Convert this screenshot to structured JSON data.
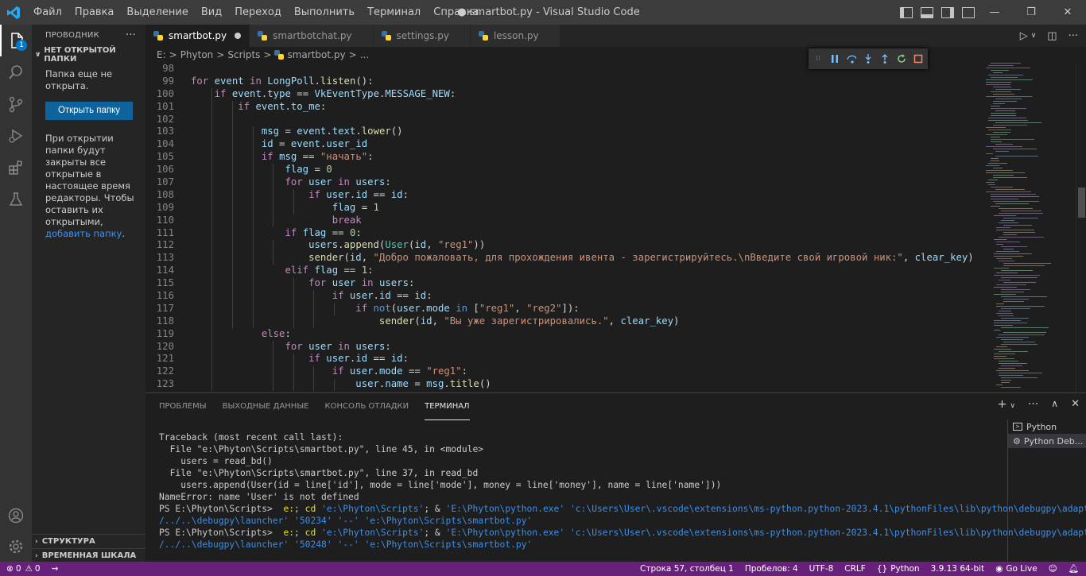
{
  "window": {
    "title": "● smartbot.py - Visual Studio Code"
  },
  "menu": [
    "Файл",
    "Правка",
    "Выделение",
    "Вид",
    "Переход",
    "Выполнить",
    "Терминал",
    "Справка"
  ],
  "sidebar": {
    "title": "ПРОВОДНИК",
    "section": "НЕТ ОТКРЫТОЙ ПАПКИ",
    "no_folder_text": "Папка еще не открыта.",
    "open_folder_label": "Открыть папку",
    "info_text": "При открытии папки будут закрыты все открытые в настоящее время редакторы. Чтобы оставить их открытыми, ",
    "info_link": "добавить папку",
    "info_end": ".",
    "outline": "СТРУКТУРА",
    "timeline": "ВРЕМЕННАЯ ШКАЛА",
    "badge": "1"
  },
  "tabs": [
    {
      "label": "smartbot.py",
      "active": true,
      "modified": true
    },
    {
      "label": "smartbotchat.py",
      "active": false
    },
    {
      "label": "settings.py",
      "active": false
    },
    {
      "label": "lesson.py",
      "active": false
    }
  ],
  "breadcrumb": [
    "E:",
    ">",
    "Phyton",
    ">",
    "Scripts",
    ">",
    "smartbot.py",
    ">",
    "..."
  ],
  "code_lines": [
    {
      "n": "98",
      "html": ""
    },
    {
      "n": "99",
      "html": "<span class=\"k\">for</span> <span class=\"v\">event</span> <span class=\"k\">in</span> <span class=\"v\">LongPoll</span>.<span class=\"f\">listen</span>():"
    },
    {
      "n": "100",
      "html": "    <span class=\"k\">if</span> <span class=\"v\">event</span>.<span class=\"v\">type</span> == <span class=\"v\">VkEventType</span>.<span class=\"v\">MESSAGE_NEW</span>:"
    },
    {
      "n": "101",
      "html": "        <span class=\"k\">if</span> <span class=\"v\">event</span>.<span class=\"v\">to_me</span>:"
    },
    {
      "n": "102",
      "html": ""
    },
    {
      "n": "103",
      "html": "            <span class=\"v\">msg</span> = <span class=\"v\">event</span>.<span class=\"v\">text</span>.<span class=\"f\">lower</span>()"
    },
    {
      "n": "104",
      "html": "            <span class=\"v\">id</span> = <span class=\"v\">event</span>.<span class=\"v\">user_id</span>"
    },
    {
      "n": "105",
      "html": "            <span class=\"k\">if</span> <span class=\"v\">msg</span> == <span class=\"s\">\"начать\"</span>:"
    },
    {
      "n": "106",
      "html": "                <span class=\"v\">flag</span> = <span class=\"n\">0</span>"
    },
    {
      "n": "107",
      "html": "                <span class=\"k\">for</span> <span class=\"v\">user</span> <span class=\"k\">in</span> <span class=\"v\">users</span>:"
    },
    {
      "n": "108",
      "html": "                    <span class=\"k\">if</span> <span class=\"v\">user</span>.<span class=\"v\">id</span> == <span class=\"v\">id</span>:"
    },
    {
      "n": "109",
      "html": "                        <span class=\"v\">flag</span> = <span class=\"n\">1</span>"
    },
    {
      "n": "110",
      "html": "                        <span class=\"k\">break</span>"
    },
    {
      "n": "111",
      "html": "                <span class=\"k\">if</span> <span class=\"v\">flag</span> == <span class=\"n\">0</span>:"
    },
    {
      "n": "112",
      "html": "                    <span class=\"v\">users</span>.<span class=\"f\">append</span>(<span class=\"c\">User</span>(<span class=\"v\">id</span>, <span class=\"s\">\"reg1\"</span>))"
    },
    {
      "n": "113",
      "html": "                    <span class=\"f\">sender</span>(<span class=\"v\">id</span>, <span class=\"s\">\"Добро пожаловать, для прохождения ивента - зарегистрируйтесь.\\nВведите свой игровой ник:\"</span>, <span class=\"v\">clear_key</span>)"
    },
    {
      "n": "114",
      "html": "                <span class=\"k\">elif</span> <span class=\"v\">flag</span> == <span class=\"n\">1</span>:"
    },
    {
      "n": "115",
      "html": "                    <span class=\"k\">for</span> <span class=\"v\">user</span> <span class=\"k\">in</span> <span class=\"v\">users</span>:"
    },
    {
      "n": "116",
      "html": "                        <span class=\"k\">if</span> <span class=\"v\">user</span>.<span class=\"v\">id</span> == <span class=\"v\">id</span>:"
    },
    {
      "n": "117",
      "html": "                            <span class=\"k\">if</span> <span class=\"b\">not</span>(<span class=\"v\">user</span>.<span class=\"v\">mode</span> <span class=\"b\">in</span> [<span class=\"s\">\"reg1\"</span>, <span class=\"s\">\"reg2\"</span>]):"
    },
    {
      "n": "118",
      "html": "                                <span class=\"f\">sender</span>(<span class=\"v\">id</span>, <span class=\"s\">\"Вы уже зарегистрировались.\"</span>, <span class=\"v\">clear_key</span>)"
    },
    {
      "n": "119",
      "html": "            <span class=\"k\">else</span>:"
    },
    {
      "n": "120",
      "html": "                <span class=\"k\">for</span> <span class=\"v\">user</span> <span class=\"k\">in</span> <span class=\"v\">users</span>:"
    },
    {
      "n": "121",
      "html": "                    <span class=\"k\">if</span> <span class=\"v\">user</span>.<span class=\"v\">id</span> == <span class=\"v\">id</span>:"
    },
    {
      "n": "122",
      "html": "                        <span class=\"k\">if</span> <span class=\"v\">user</span>.<span class=\"v\">mode</span> == <span class=\"s\">\"reg1\"</span>:"
    },
    {
      "n": "123",
      "html": "                            <span class=\"v\">user</span>.<span class=\"v\">name</span> = <span class=\"v\">msg</span>.<span class=\"f\">title</span>()"
    }
  ],
  "panel": {
    "tabs": [
      "ПРОБЛЕМЫ",
      "ВЫХОДНЫЕ ДАННЫЕ",
      "КОНСОЛЬ ОТЛАДКИ",
      "ТЕРМИНАЛ"
    ],
    "active_tab": "ТЕРМИНАЛ",
    "terminals": [
      "Python",
      "Python Deb..."
    ]
  },
  "terminal_lines": [
    {
      "html": "Traceback (most recent call last):"
    },
    {
      "html": "  File \"e:\\Phyton\\Scripts\\smartbot.py\", line 45, in &lt;module&gt;"
    },
    {
      "html": "    users = read_bd()"
    },
    {
      "html": "  File \"e:\\Phyton\\Scripts\\smartbot.py\", line 37, in read_bd"
    },
    {
      "html": "    users.append(User(id = line['id'], mode = line['mode'], money = line['money'], name = line['name']))"
    },
    {
      "html": "NameError: name 'User' is not defined"
    },
    {
      "html": "PS E:\\Phyton\\Scripts>  <span class=\"y\">e:</span>; <span class=\"y\">cd</span> <span class=\"bl\">'e:\\Phyton\\Scripts'</span>; &amp; <span class=\"bl\">'E:\\Phyton\\python.exe'</span> <span class=\"bl\">'c:\\Users\\User\\.vscode\\extensions\\ms-python.python-2023.4.1\\pythonFiles\\lib\\python\\debugpy\\adapter</span>"
    },
    {
      "html": "<span class=\"bl\">/../..\\debugpy\\launcher'</span> <span class=\"bl\">'50234'</span> <span class=\"bl\">'--'</span> <span class=\"bl\">'e:\\Phyton\\Scripts\\smartbot.py'</span>"
    },
    {
      "html": "PS E:\\Phyton\\Scripts>  <span class=\"y\">e:</span>; <span class=\"y\">cd</span> <span class=\"bl\">'e:\\Phyton\\Scripts'</span>; &amp; <span class=\"bl\">'E:\\Phyton\\python.exe'</span> <span class=\"bl\">'c:\\Users\\User\\.vscode\\extensions\\ms-python.python-2023.4.1\\pythonFiles\\lib\\python\\debugpy\\adapter</span>"
    },
    {
      "html": "<span class=\"bl\">/../..\\debugpy\\launcher'</span> <span class=\"bl\">'50248'</span> <span class=\"bl\">'--'</span> <span class=\"bl\">'e:\\Phyton\\Scripts\\smartbot.py'</span>"
    }
  ],
  "statusbar": {
    "errors": "0",
    "warnings": "0",
    "position": "Строка 57, столбец 1",
    "spaces": "Пробелов: 4",
    "encoding": "UTF-8",
    "eol": "CRLF",
    "language": "Python",
    "interpreter": "3.9.13 64-bit",
    "golive": "Go Live"
  },
  "colors": {
    "statusbar": "#68217a",
    "accent": "#0e639c",
    "link": "#3794ff"
  }
}
